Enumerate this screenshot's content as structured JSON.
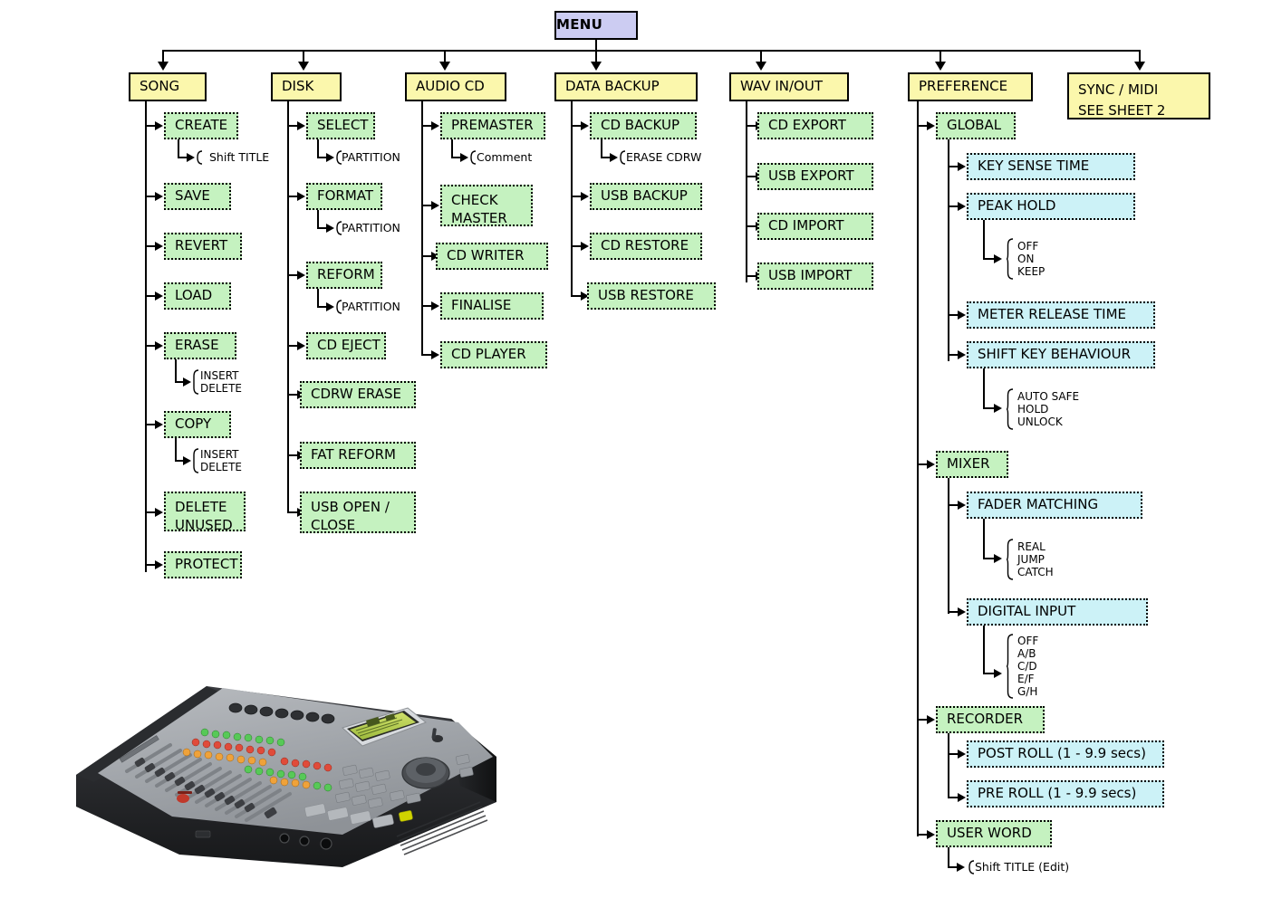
{
  "diagram": {
    "title": "MENU",
    "root": {
      "label": "MENU"
    },
    "columns": [
      {
        "id": "song",
        "label": "SONG",
        "items": [
          {
            "label": "CREATE",
            "options": [
              "Shift TITLE"
            ]
          },
          {
            "label": "SAVE",
            "options": []
          },
          {
            "label": "REVERT",
            "options": []
          },
          {
            "label": "LOAD",
            "options": []
          },
          {
            "label": "ERASE",
            "options": [
              "INSERT",
              "DELETE"
            ]
          },
          {
            "label": "COPY",
            "options": [
              "INSERT",
              "DELETE"
            ]
          },
          {
            "label": "DELETE UNUSED",
            "options": []
          },
          {
            "label": "PROTECT",
            "options": []
          }
        ]
      },
      {
        "id": "disk",
        "label": "DISK",
        "items": [
          {
            "label": "SELECT",
            "options": [
              "PARTITION"
            ]
          },
          {
            "label": "FORMAT",
            "options": [
              "PARTITION"
            ]
          },
          {
            "label": "REFORM",
            "options": [
              "PARTITION"
            ]
          },
          {
            "label": "CD EJECT",
            "options": []
          },
          {
            "label": "CDRW ERASE",
            "options": []
          },
          {
            "label": "FAT REFORM",
            "options": []
          },
          {
            "label": "USB OPEN / CLOSE",
            "options": []
          }
        ]
      },
      {
        "id": "audio-cd",
        "label": "AUDIO CD",
        "items": [
          {
            "label": "PREMASTER",
            "options": [
              "Comment"
            ]
          },
          {
            "label": "CHECK MASTER",
            "options": []
          },
          {
            "label": "CD WRITER",
            "options": []
          },
          {
            "label": "FINALISE",
            "options": []
          },
          {
            "label": "CD PLAYER",
            "options": []
          }
        ]
      },
      {
        "id": "data-backup",
        "label": "DATA BACKUP",
        "items": [
          {
            "label": "CD BACKUP",
            "options": [
              "ERASE CDRW"
            ]
          },
          {
            "label": "USB BACKUP",
            "options": []
          },
          {
            "label": "CD RESTORE",
            "options": []
          },
          {
            "label": "USB RESTORE",
            "options": []
          }
        ]
      },
      {
        "id": "wav-in-out",
        "label": "WAV IN/OUT",
        "items": [
          {
            "label": "CD EXPORT",
            "options": []
          },
          {
            "label": "USB EXPORT",
            "options": []
          },
          {
            "label": "CD IMPORT",
            "options": []
          },
          {
            "label": "USB IMPORT",
            "options": []
          }
        ]
      },
      {
        "id": "preference",
        "label": "PREFERENCE",
        "groups": [
          {
            "label": "GLOBAL",
            "items": [
              {
                "label": "KEY SENSE TIME",
                "options": []
              },
              {
                "label": "PEAK HOLD",
                "options": [
                  "OFF",
                  "ON",
                  "KEEP"
                ]
              },
              {
                "label": "METER RELEASE TIME",
                "options": []
              },
              {
                "label": "SHIFT KEY BEHAVIOUR",
                "options": [
                  "AUTO SAFE",
                  "HOLD",
                  "UNLOCK"
                ]
              }
            ]
          },
          {
            "label": "MIXER",
            "items": [
              {
                "label": "FADER MATCHING",
                "options": [
                  "REAL",
                  "JUMP",
                  "CATCH"
                ]
              },
              {
                "label": "DIGITAL INPUT",
                "options": [
                  "OFF",
                  "A/B",
                  "C/D",
                  "E/F",
                  "G/H"
                ]
              }
            ]
          },
          {
            "label": "RECORDER",
            "items": [
              {
                "label": "POST ROLL (1 - 9.9 secs)",
                "options": []
              },
              {
                "label": "PRE ROLL (1 - 9.9 secs)",
                "options": []
              }
            ]
          },
          {
            "label": "USER WORD",
            "items": [],
            "options": [
              "Shift TITLE (Edit)"
            ]
          }
        ]
      },
      {
        "id": "sync-midi",
        "label": "SYNC / MIDI",
        "label_line2": "SEE SHEET 2",
        "items": []
      }
    ]
  },
  "photo": {
    "caption": "digital mixing console / multitrack recorder"
  },
  "colors": {
    "root_fill": "#ccccf2",
    "category_fill": "#fbf7ac",
    "level2_fill": "#c5f2c0",
    "level3_fill": "#ccf2f7",
    "line": "#000000",
    "page_bg": "#ffffff"
  }
}
